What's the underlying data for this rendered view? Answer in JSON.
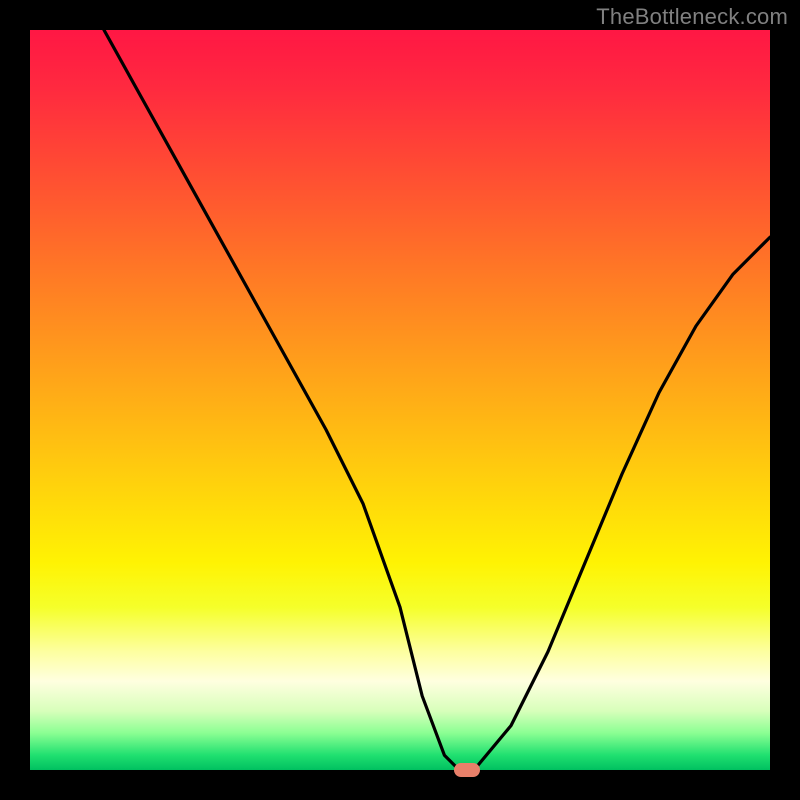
{
  "watermark": "TheBottleneck.com",
  "chart_data": {
    "type": "line",
    "title": "",
    "xlabel": "",
    "ylabel": "",
    "xlim": [
      0,
      100
    ],
    "ylim": [
      0,
      100
    ],
    "background_gradient": {
      "top": "#ff1744",
      "upper_mid": "#ffa818",
      "lower_mid": "#fdffa0",
      "bottom": "#00c060",
      "meaning": "red = high bottleneck, green = low bottleneck"
    },
    "series": [
      {
        "name": "bottleneck-curve",
        "x": [
          10,
          15,
          20,
          25,
          30,
          35,
          40,
          45,
          50,
          53,
          56,
          58,
          60,
          65,
          70,
          75,
          80,
          85,
          90,
          95,
          100
        ],
        "y": [
          100,
          91,
          82,
          73,
          64,
          55,
          46,
          36,
          22,
          10,
          2,
          0,
          0,
          6,
          16,
          28,
          40,
          51,
          60,
          67,
          72
        ]
      }
    ],
    "annotations": [
      {
        "name": "optimal-marker",
        "x": 59,
        "y": 0,
        "color": "#e8806a"
      }
    ]
  }
}
